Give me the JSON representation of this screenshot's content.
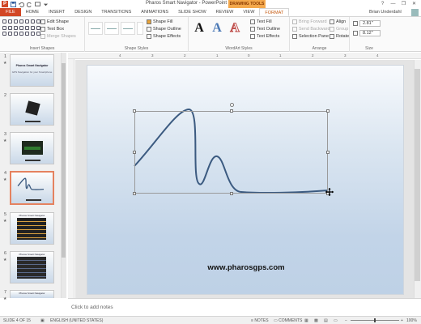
{
  "window": {
    "title": "Pharos Smart Navigator - PowerPoint",
    "contextual_tab_group": "DRAWING TOOLS",
    "user": "Brian Underdahl",
    "controls": [
      "?",
      "—",
      "❐",
      "✕"
    ]
  },
  "tabs": [
    "FILE",
    "HOME",
    "INSERT",
    "DESIGN",
    "TRANSITIONS",
    "ANIMATIONS",
    "SLIDE SHOW",
    "REVIEW",
    "VIEW",
    "FORMAT"
  ],
  "ribbon": {
    "insert_shapes": {
      "label": "Insert Shapes",
      "edit_shape": "Edit Shape",
      "text_box": "Text Box",
      "merge_shapes": "Merge Shapes"
    },
    "shape_styles": {
      "label": "Shape Styles",
      "fill": "Shape Fill",
      "outline": "Shape Outline",
      "effects": "Shape Effects"
    },
    "wordart_styles": {
      "label": "WordArt Styles",
      "letters": [
        "A",
        "A",
        "A"
      ],
      "text_fill": "Text Fill",
      "text_outline": "Text Outline",
      "text_effects": "Text Effects"
    },
    "arrange": {
      "label": "Arrange",
      "bring_forward": "Bring Forward",
      "send_backward": "Send Backward",
      "selection_pane": "Selection Pane",
      "align": "Align",
      "group": "Group",
      "rotate": "Rotate"
    },
    "size": {
      "label": "Size",
      "height": "2.81\"",
      "width": "8.12\""
    }
  },
  "ruler": {
    "ticks": [
      "4",
      "3",
      "2",
      "1",
      "0",
      "1",
      "2",
      "3",
      "4"
    ]
  },
  "thumbnails": [
    {
      "num": "1",
      "title": "Pharos Smart Navigator",
      "subtitle": "GPS Navigation for your Smartphone"
    },
    {
      "num": "2",
      "title": ""
    },
    {
      "num": "3",
      "title": ""
    },
    {
      "num": "4",
      "title": ""
    },
    {
      "num": "5",
      "title": "Pharos Smart Navigator"
    },
    {
      "num": "6",
      "title": "Pharos Smart Navigator"
    },
    {
      "num": "7",
      "title": "Pharos Smart Navigator"
    }
  ],
  "slide": {
    "url": "www.pharosgps.com"
  },
  "notes": {
    "placeholder": "Click to add notes"
  },
  "status": {
    "slide_counter": "SLIDE 4 OF 15",
    "language": "ENGLISH (UNITED STATES)",
    "notes": "NOTES",
    "comments": "COMMENTS",
    "zoom": "100%"
  },
  "colors": {
    "file_tab": "#d24726",
    "contextual": "#f4a94d",
    "curve": "#3b5a80",
    "active_thumb_border": "#e5825f"
  }
}
